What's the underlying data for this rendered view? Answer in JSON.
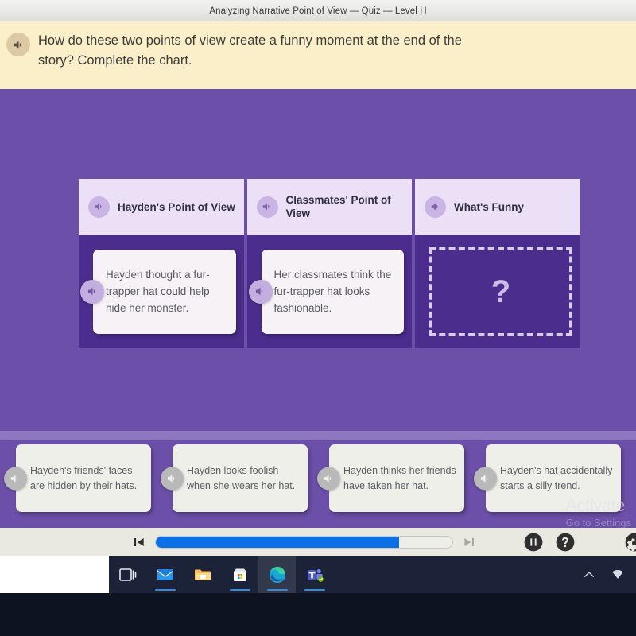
{
  "window": {
    "title": "Analyzing Narrative Point of View — Quiz — Level H"
  },
  "question": {
    "text": "How do these two points of view create a funny moment at the end of the story? Complete the chart.",
    "audio_icon": "speaker-icon"
  },
  "chart": {
    "columns": [
      {
        "header": "Hayden's Point of View",
        "statement": "Hayden thought a fur-trapper hat could help hide her monster.",
        "is_dropzone": false
      },
      {
        "header": "Classmates' Point of View",
        "statement": "Her classmates think the fur-trapper hat looks fashionable.",
        "is_dropzone": false
      },
      {
        "header": "What's Funny",
        "statement": "",
        "is_dropzone": true,
        "dropzone_placeholder": "?"
      }
    ]
  },
  "answer_bank": {
    "options": [
      "Hayden's friends' faces are hidden by their hats.",
      "Hayden looks foolish when she wears her hat.",
      "Hayden thinks her friends have taken her hat.",
      "Hayden's hat accidentally starts a silly trend."
    ]
  },
  "watermark": {
    "line1": "Activate",
    "line2": "Go to Settings"
  },
  "toolbar": {
    "previous_icon": "skip-previous-icon",
    "next_icon": "skip-next-icon",
    "pause_icon": "pause-icon",
    "help_icon": "help-icon",
    "settings_icon": "gear-icon",
    "progress_percent": 82,
    "progress_fill_color": "#0b6fe8"
  },
  "taskbar": {
    "items": [
      {
        "icon": "task-view-icon",
        "active": false,
        "running": false
      },
      {
        "icon": "mail-icon",
        "active": false,
        "running": true
      },
      {
        "icon": "file-explorer-icon",
        "active": false,
        "running": false
      },
      {
        "icon": "microsoft-store-icon",
        "active": false,
        "running": true
      },
      {
        "icon": "edge-browser-icon",
        "active": true,
        "running": true
      },
      {
        "icon": "microsoft-teams-icon",
        "active": false,
        "running": true
      }
    ],
    "tray": [
      {
        "icon": "chevron-up-icon"
      },
      {
        "icon": "wifi-icon"
      }
    ]
  },
  "colors": {
    "page_purple": "#6b4fa8",
    "chart_purple": "#4a2d8c",
    "header_lavender": "#ece0f7",
    "banner_yellow": "#faefc8",
    "card_white": "#f7f2f6",
    "answer_card": "#edefe8"
  }
}
